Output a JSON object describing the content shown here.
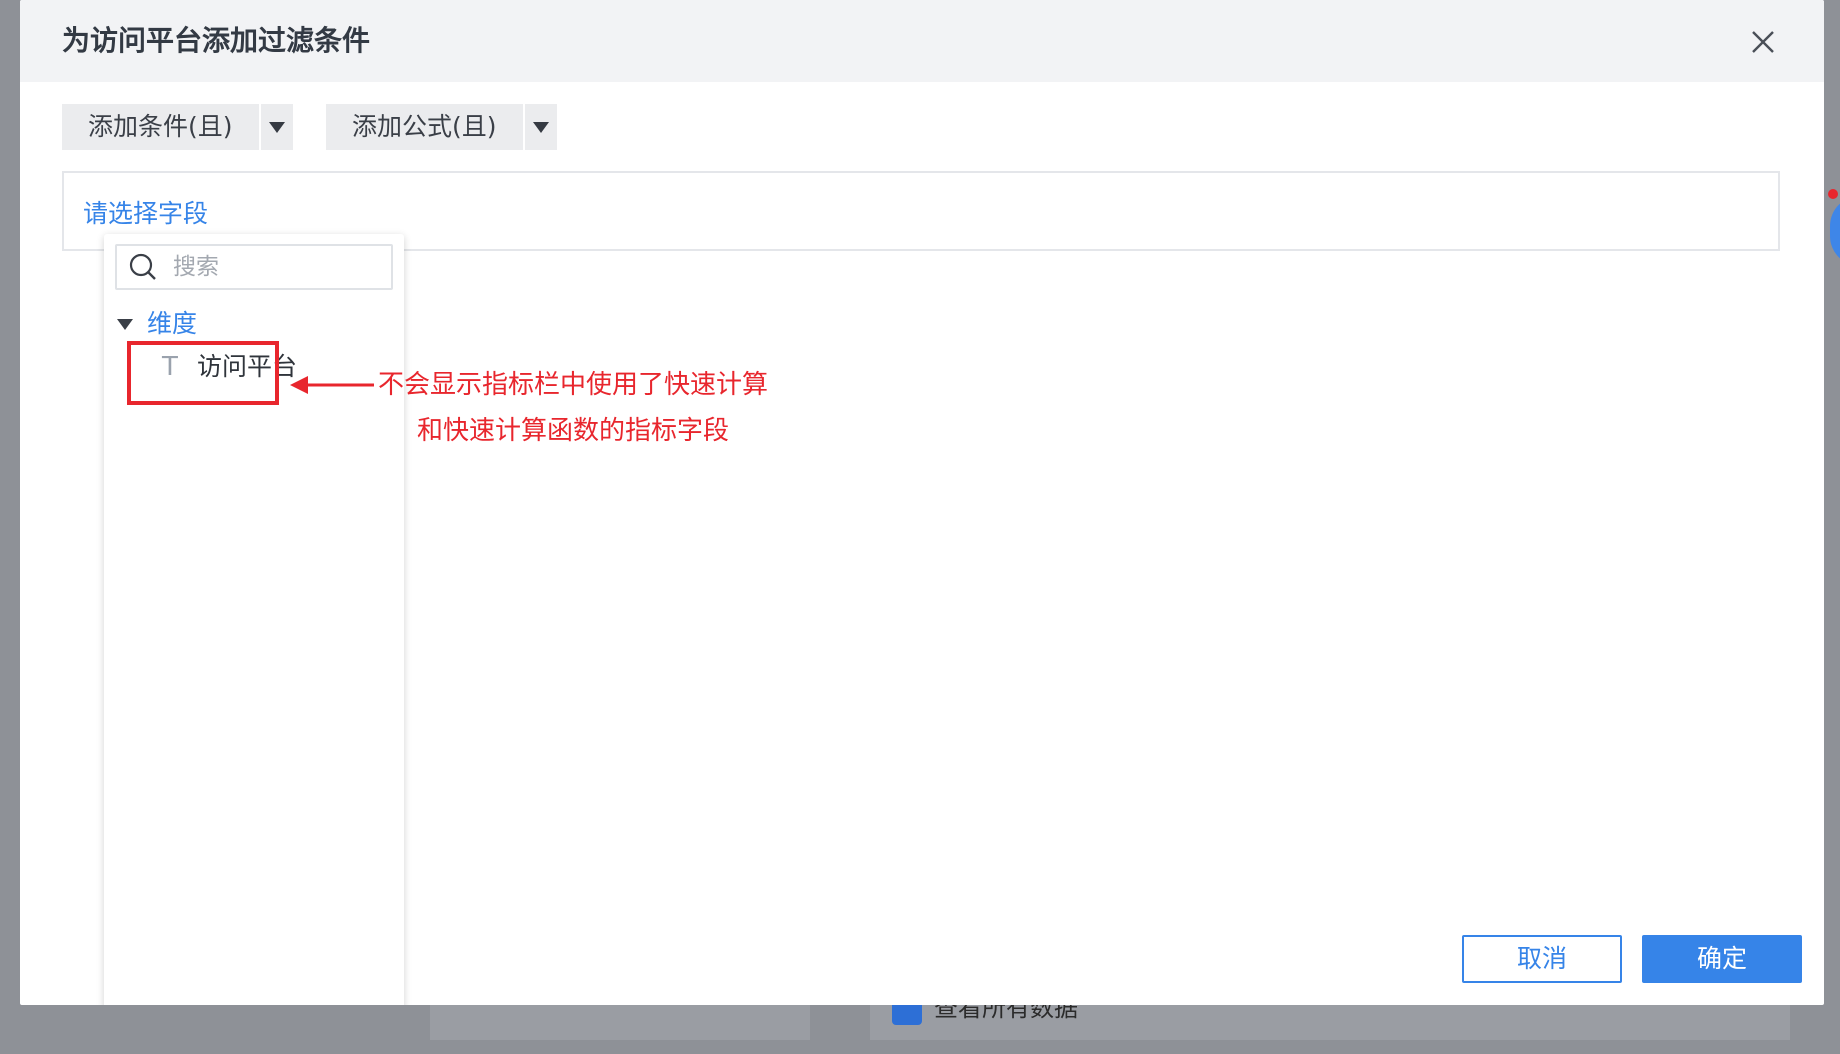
{
  "dialog": {
    "title": "为访问平台添加过滤条件"
  },
  "toolbar": {
    "add_condition_label": "添加条件(且)",
    "add_formula_label": "添加公式(且)"
  },
  "condition": {
    "select_field_label": "请选择字段"
  },
  "field_panel": {
    "search_placeholder": "搜索",
    "group_label": "维度",
    "item_type_icon": "T",
    "item_label": "访问平台"
  },
  "annotation": {
    "text": "不会显示指标栏中使用了快速计算和快速计算函数的指标字段"
  },
  "footer": {
    "cancel_label": "取消",
    "ok_label": "确定"
  },
  "background": {
    "checkbox_text": "查看所有数据"
  },
  "colors": {
    "accent": "#3684e8",
    "annotation": "#e8262d"
  }
}
